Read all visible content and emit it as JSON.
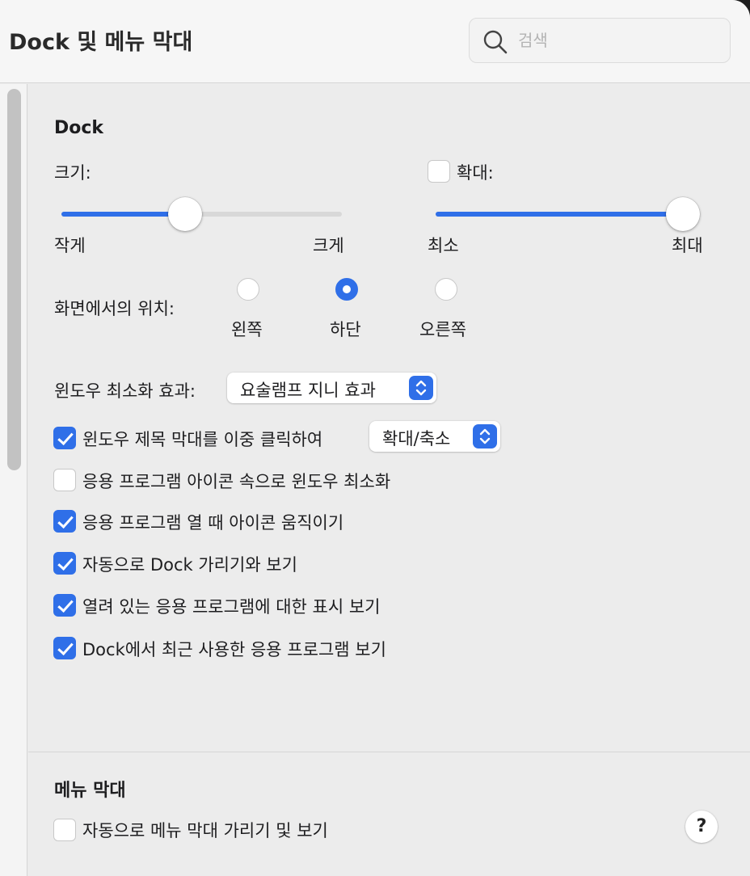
{
  "window": {
    "title": "Dock 및 메뉴 막대",
    "search_placeholder": "검색"
  },
  "dock": {
    "section_title": "Dock",
    "size": {
      "label": "크기:",
      "min_label": "작게",
      "max_label": "크게",
      "value_fraction": 0.44
    },
    "magnification": {
      "label": "확대:",
      "checked": false,
      "min_label": "최소",
      "max_label": "최대",
      "value_fraction": 1.0
    },
    "position": {
      "label": "화면에서의 위치:",
      "options": [
        {
          "label": "왼쪽",
          "selected": false
        },
        {
          "label": "하단",
          "selected": true
        },
        {
          "label": "오른쪽",
          "selected": false
        }
      ]
    },
    "minimize_effect": {
      "label": "윈도우 최소화 효과:",
      "value": "요술램프 지니 효과"
    },
    "double_click": {
      "label": "윈도우 제목 막대를 이중 클릭하여",
      "checked": true,
      "value": "확대/축소"
    },
    "options": [
      {
        "label": "응용 프로그램 아이콘 속으로 윈도우 최소화",
        "checked": false
      },
      {
        "label": "응용 프로그램 열 때 아이콘 움직이기",
        "checked": true
      },
      {
        "label": "자동으로 Dock 가리기와 보기",
        "checked": true
      },
      {
        "label": "열려 있는 응용 프로그램에 대한 표시 보기",
        "checked": true
      },
      {
        "label": "Dock에서 최근 사용한 응용 프로그램 보기",
        "checked": true
      }
    ]
  },
  "menubar": {
    "section_title": "메뉴 막대",
    "auto_hide": {
      "label": "자동으로 메뉴 막대 가리기 및 보기",
      "checked": false
    }
  },
  "help_label": "?",
  "colors": {
    "accent": "#2f6fe8",
    "window_bg": "#ececec",
    "titlebar_bg": "#f6f6f6"
  }
}
